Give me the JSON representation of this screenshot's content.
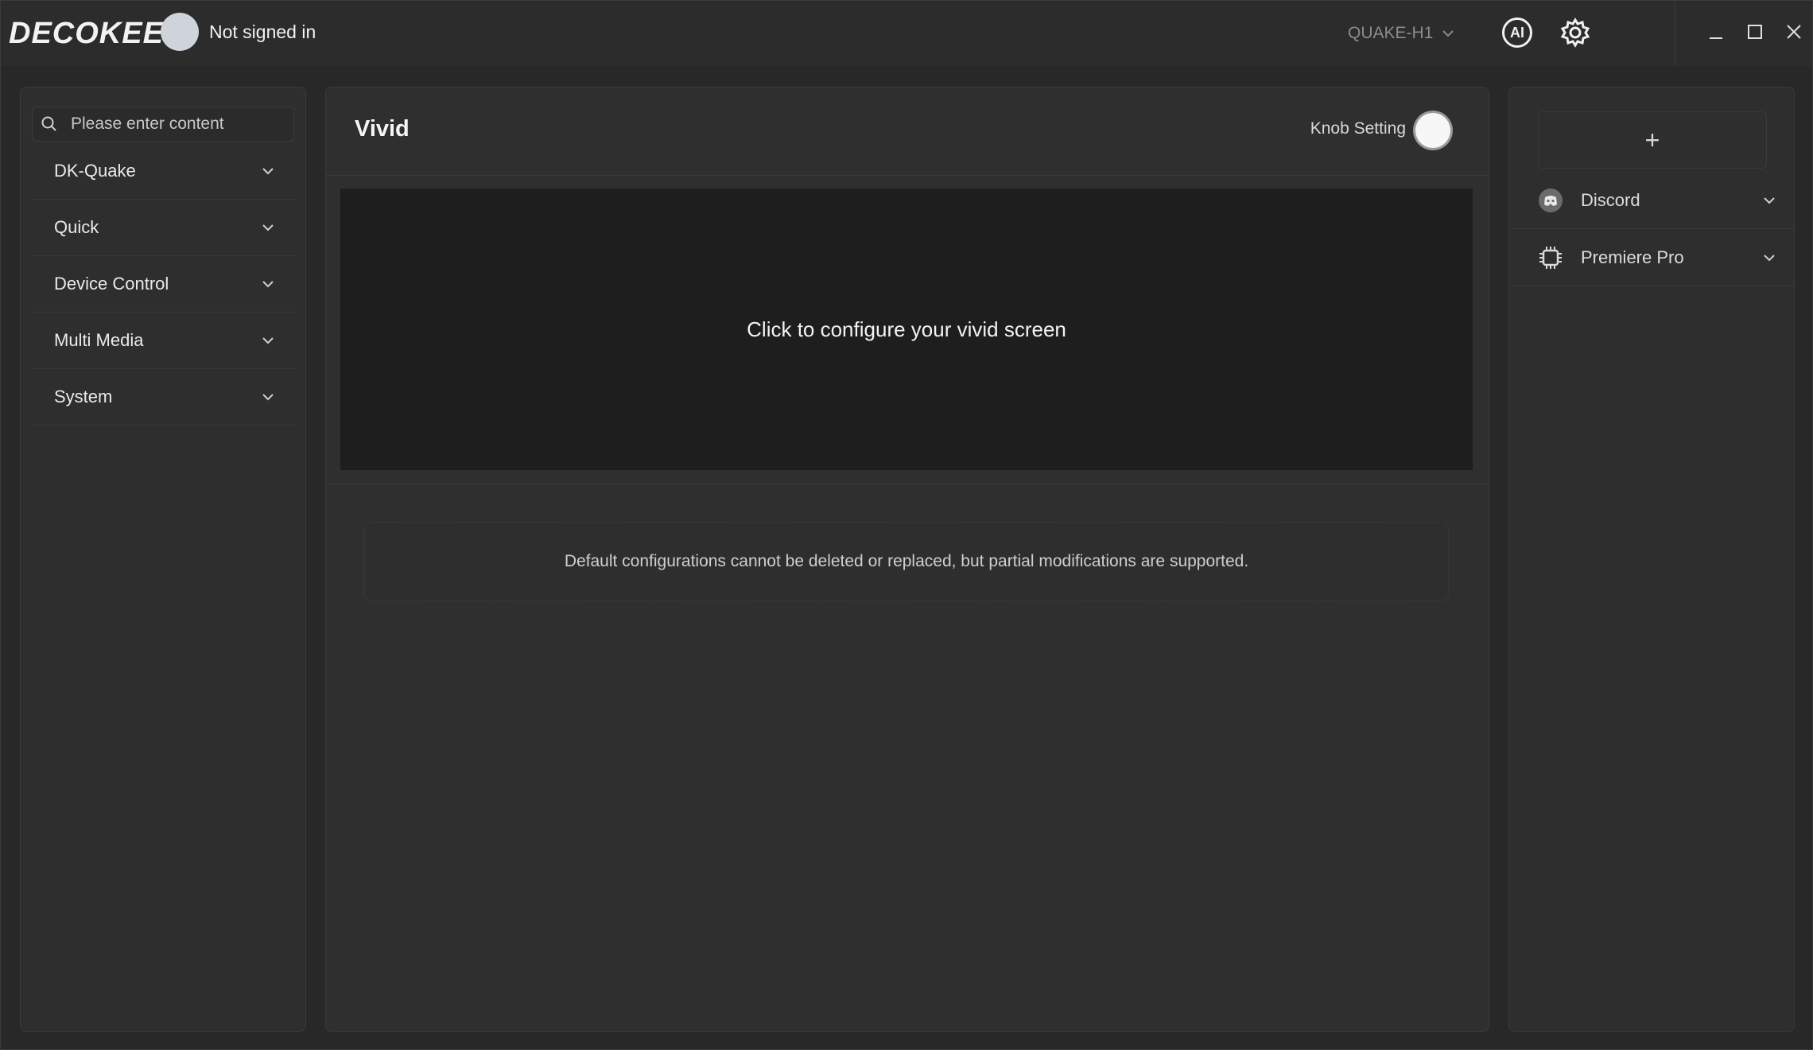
{
  "app": {
    "logo": "DECOKEE",
    "user_status": "Not signed in",
    "device": "QUAKE-H1"
  },
  "search": {
    "placeholder": "Please enter content"
  },
  "categories": [
    {
      "label": "DK-Quake"
    },
    {
      "label": "Quick"
    },
    {
      "label": "Device Control"
    },
    {
      "label": "Multi Media"
    },
    {
      "label": "System"
    }
  ],
  "vivid": {
    "title": "Vivid",
    "knob_label": "Knob Setting",
    "screen_prompt": "Click to configure your vivid screen",
    "notice": "Default configurations cannot be deleted or replaced, but partial modifications are supported."
  },
  "right": {
    "add_label": "+",
    "apps": [
      {
        "label": "Discord",
        "icon": "discord-icon"
      },
      {
        "label": "Premiere Pro",
        "icon": "chip-icon"
      }
    ]
  },
  "toolbar": {
    "ai_label": "AI"
  }
}
